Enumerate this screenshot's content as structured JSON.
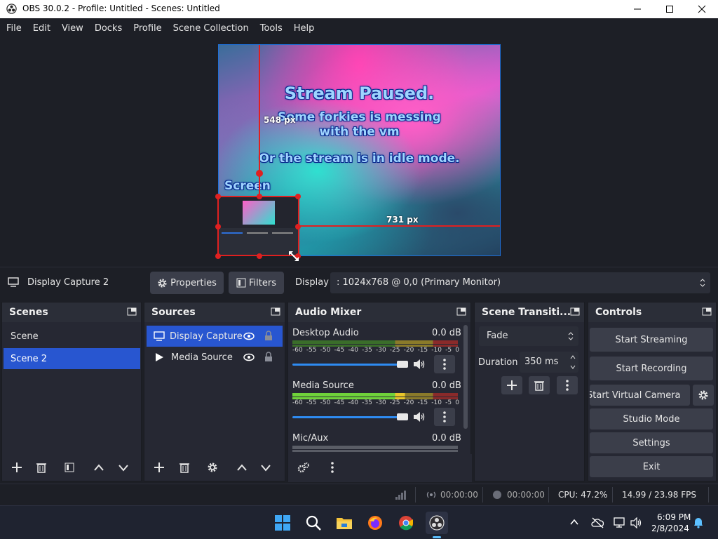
{
  "window": {
    "title": "OBS 30.0.2 - Profile: Untitled - Scenes: Untitled"
  },
  "menu": [
    "File",
    "Edit",
    "View",
    "Docks",
    "Profile",
    "Scene Collection",
    "Tools",
    "Help"
  ],
  "preview": {
    "line1": "Stream Paused.",
    "line2": "Some forkies is messing",
    "line3": "with the vm",
    "line4": "Or the stream is in idle mode.",
    "source_label": "Screen",
    "dim_vertical": "548 px",
    "dim_horizontal": "731 px"
  },
  "context_bar": {
    "source_name": "Display Capture 2",
    "properties": "Properties",
    "filters": "Filters",
    "display_label": "Display",
    "display_value": ": 1024x768 @ 0,0 (Primary Monitor)"
  },
  "scenes": {
    "title": "Scenes",
    "items": [
      "Scene",
      "Scene 2"
    ]
  },
  "sources": {
    "title": "Sources",
    "items": [
      "Display Capture",
      "Media Source"
    ]
  },
  "mixer": {
    "title": "Audio Mixer",
    "channels": [
      {
        "name": "Desktop Audio",
        "db": "0.0 dB"
      },
      {
        "name": "Media Source",
        "db": "0.0 dB"
      },
      {
        "name": "Mic/Aux",
        "db": "0.0 dB"
      }
    ],
    "ticks": [
      "-60",
      "-55",
      "-50",
      "-45",
      "-40",
      "-35",
      "-30",
      "-25",
      "-20",
      "-15",
      "-10",
      "-5",
      "0"
    ]
  },
  "transitions": {
    "title": "Scene Transiti...",
    "type": "Fade",
    "duration_label": "Duration",
    "duration_value": "350 ms"
  },
  "controls": {
    "title": "Controls",
    "start_streaming": "Start Streaming",
    "start_recording": "Start Recording",
    "start_virtual_camera": "Start Virtual Camera",
    "studio_mode": "Studio Mode",
    "settings": "Settings",
    "exit": "Exit"
  },
  "status": {
    "stream_time": "00:00:00",
    "record_time": "00:00:00",
    "cpu": "CPU: 47.2%",
    "fps": "14.99 / 23.98 FPS"
  },
  "taskbar": {
    "time": "6:09 PM",
    "date": "2/8/2024"
  }
}
